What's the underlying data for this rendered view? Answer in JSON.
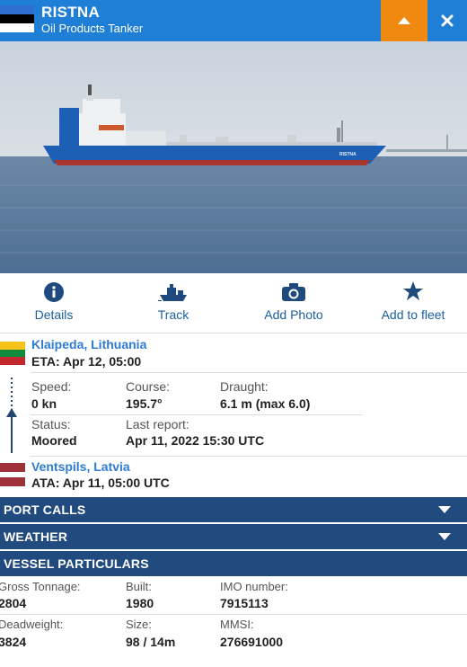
{
  "vessel": {
    "name": "RISTNA",
    "type": "Oil Products Tanker",
    "hull_text": "RISTNA"
  },
  "colors": {
    "header_blue": "#1f7fd6",
    "orange": "#f0890f",
    "bar_navy": "#214a7e",
    "link_blue": "#2e7dd2"
  },
  "header": {
    "collapse_icon": "caret-up-icon",
    "close_icon": "close-icon"
  },
  "actions": [
    {
      "label": "Details",
      "icon": "info-icon"
    },
    {
      "label": "Track",
      "icon": "ship-icon"
    },
    {
      "label": "Add Photo",
      "icon": "camera-icon"
    },
    {
      "label": "Add to fleet",
      "icon": "star-icon"
    }
  ],
  "voyage": {
    "destination": {
      "port": "Klaipeda, Lithuania",
      "eta": "ETA: Apr 12, 05:00"
    },
    "departure": {
      "port": "Ventspils, Latvia",
      "ata": "ATA: Apr 11, 05:00 UTC"
    },
    "speed_label": "Speed:",
    "speed_value": "0 kn",
    "course_label": "Course:",
    "course_value": "195.7°",
    "draught_label": "Draught:",
    "draught_value": "6.1 m (max 6.0)",
    "status_label": "Status:",
    "status_value": "Moored",
    "last_report_label": "Last report:",
    "last_report_value": "Apr 11, 2022 15:30 UTC"
  },
  "sections": {
    "port_calls": "PORT CALLS",
    "weather": "WEATHER",
    "particulars": "VESSEL PARTICULARS"
  },
  "particulars": {
    "gross_tonnage_label": "Gross Tonnage:",
    "gross_tonnage_value": "2804",
    "built_label": "Built:",
    "built_value": "1980",
    "imo_label": "IMO number:",
    "imo_value": "7915113",
    "deadweight_label": "Deadweight:",
    "deadweight_value": "3824",
    "size_label": "Size:",
    "size_value": "98 / 14m",
    "mmsi_label": "MMSI:",
    "mmsi_value": "276691000"
  }
}
